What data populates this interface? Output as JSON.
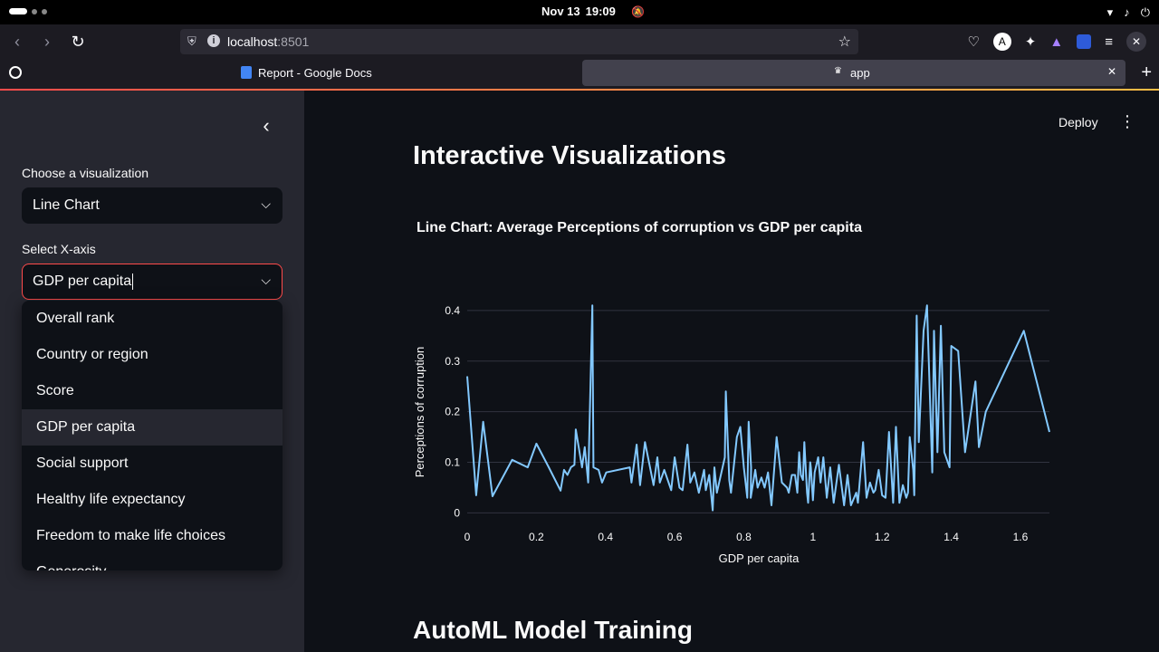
{
  "os": {
    "date": "Nov 13",
    "time": "19:09"
  },
  "browser": {
    "url_host": "localhost",
    "url_port": ":8501",
    "tabs": [
      {
        "label": "Report - Google Docs"
      },
      {
        "label": "app"
      }
    ]
  },
  "sidebar": {
    "viz_label": "Choose a visualization",
    "viz_value": "Line Chart",
    "x_label": "Select X-axis",
    "x_value": "GDP per capita",
    "options": [
      "Overall rank",
      "Country or region",
      "Score",
      "GDP per capita",
      "Social support",
      "Healthy life expectancy",
      "Freedom to make life choices",
      "Generosity"
    ],
    "hovered_option": "GDP per capita"
  },
  "main": {
    "deploy_label": "Deploy",
    "heading": "Interactive Visualizations",
    "section2_heading": "AutoML Model Training"
  },
  "colors": {
    "accent": "#ff4b4b",
    "line": "#83c9ff",
    "background": "#0e1117",
    "sidebar": "#262730"
  },
  "icons": {
    "back": "arrow-left-icon",
    "forward": "arrow-right-icon",
    "reload": "reload-icon",
    "star": "bookmark-star-icon",
    "collapse": "chevron-left-icon",
    "select": "chevron-down-icon",
    "menu": "vertical-dots-icon"
  },
  "chart_data": {
    "type": "line",
    "title": "Line Chart: Average Perceptions of corruption vs GDP per capita",
    "xlabel": "GDP per capita",
    "ylabel": "Perceptions of corruption",
    "xlim": [
      0,
      1.684
    ],
    "ylim": [
      -0.01,
      0.45
    ],
    "x_ticks": [
      0,
      0.2,
      0.4,
      0.6,
      0.8,
      1,
      1.2,
      1.4,
      1.6
    ],
    "x_tick_labels": [
      "0",
      "0.2",
      "0.4",
      "0.6",
      "0.8",
      "1",
      "1.2",
      "1.4",
      "1.6"
    ],
    "y_ticks": [
      0,
      0.1,
      0.2,
      0.3,
      0.4
    ],
    "y_tick_labels": [
      "0",
      "0.1",
      "0.2",
      "0.3",
      "0.4"
    ],
    "grid": true,
    "series": [
      {
        "x": [
          0.0,
          0.026,
          0.046,
          0.073,
          0.13,
          0.175,
          0.2,
          0.236,
          0.27,
          0.28,
          0.29,
          0.3,
          0.31,
          0.314,
          0.332,
          0.34,
          0.35,
          0.362,
          0.365,
          0.38,
          0.39,
          0.402,
          0.47,
          0.475,
          0.49,
          0.5,
          0.514,
          0.539,
          0.55,
          0.557,
          0.57,
          0.59,
          0.6,
          0.614,
          0.623,
          0.637,
          0.645,
          0.657,
          0.67,
          0.685,
          0.69,
          0.7,
          0.71,
          0.715,
          0.722,
          0.745,
          0.748,
          0.758,
          0.763,
          0.78,
          0.79,
          0.8,
          0.81,
          0.814,
          0.821,
          0.82,
          0.833,
          0.84,
          0.851,
          0.86,
          0.87,
          0.88,
          0.895,
          0.91,
          0.925,
          0.93,
          0.939,
          0.948,
          0.955,
          0.96,
          0.965,
          0.971,
          0.975,
          0.983,
          0.986,
          0.992,
          0.994,
          1.0,
          1.005,
          1.015,
          1.022,
          1.03,
          1.04,
          1.05,
          1.06,
          1.075,
          1.09,
          1.1,
          1.11,
          1.125,
          1.13,
          1.145,
          1.155,
          1.165,
          1.175,
          1.18,
          1.19,
          1.2,
          1.21,
          1.22,
          1.232,
          1.24,
          1.25,
          1.26,
          1.27,
          1.275,
          1.28,
          1.29,
          1.293,
          1.3,
          1.306,
          1.32,
          1.33,
          1.34,
          1.345,
          1.35,
          1.36,
          1.37,
          1.38,
          1.395,
          1.4,
          1.42,
          1.44,
          1.47,
          1.48,
          1.5,
          1.61,
          1.684
        ],
        "y": [
          0.27,
          0.035,
          0.18,
          0.033,
          0.105,
          0.09,
          0.137,
          0.09,
          0.044,
          0.085,
          0.075,
          0.09,
          0.095,
          0.165,
          0.09,
          0.13,
          0.06,
          0.41,
          0.09,
          0.085,
          0.06,
          0.08,
          0.09,
          0.06,
          0.135,
          0.055,
          0.14,
          0.055,
          0.11,
          0.06,
          0.085,
          0.045,
          0.11,
          0.05,
          0.045,
          0.135,
          0.06,
          0.08,
          0.04,
          0.085,
          0.045,
          0.075,
          0.005,
          0.09,
          0.04,
          0.11,
          0.24,
          0.065,
          0.04,
          0.15,
          0.17,
          0.09,
          0.03,
          0.18,
          0.09,
          0.03,
          0.085,
          0.05,
          0.07,
          0.05,
          0.08,
          0.015,
          0.15,
          0.06,
          0.05,
          0.04,
          0.075,
          0.075,
          0.04,
          0.12,
          0.075,
          0.065,
          0.14,
          0.04,
          0.02,
          0.1,
          0.09,
          0.025,
          0.08,
          0.11,
          0.06,
          0.11,
          0.03,
          0.09,
          0.02,
          0.095,
          0.015,
          0.075,
          0.015,
          0.04,
          0.02,
          0.14,
          0.03,
          0.06,
          0.04,
          0.045,
          0.085,
          0.035,
          0.03,
          0.16,
          0.02,
          0.17,
          0.02,
          0.055,
          0.03,
          0.04,
          0.15,
          0.085,
          0.035,
          0.39,
          0.14,
          0.36,
          0.41,
          0.19,
          0.08,
          0.36,
          0.12,
          0.37,
          0.12,
          0.09,
          0.33,
          0.32,
          0.12,
          0.26,
          0.13,
          0.2,
          0.36,
          0.16
        ]
      }
    ]
  }
}
